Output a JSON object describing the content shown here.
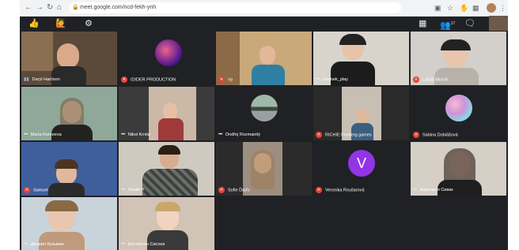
{
  "browser": {
    "url": "meet.google.com/ncd-fekh-ynh",
    "back_icon": "arrow-left",
    "forward_icon": "arrow-right",
    "reload_icon": "reload",
    "home_icon": "home"
  },
  "meet_toolbar": {
    "left_icons": [
      "thumbs-up-emoji",
      "person-raising-hand-emoji",
      "settings-gear"
    ],
    "right_icons": [
      "grid-layout",
      "people",
      "chat"
    ],
    "participant_count": "17"
  },
  "participants": [
    {
      "name": "Daryl Harrison",
      "status": "speaking"
    },
    {
      "name": "IDIDER PRODUCTION",
      "status": "muted"
    },
    {
      "name": "Vy",
      "status": "muted"
    },
    {
      "name": "Lisenek_play",
      "status": "more"
    },
    {
      "name": "Lukáš Muroň",
      "status": "muted"
    },
    {
      "name": "Maria Korneeva",
      "status": "more"
    },
    {
      "name": "Nikol Krnita",
      "status": "more"
    },
    {
      "name": "Ondřej Rozmanitý",
      "status": "more"
    },
    {
      "name": "RICHIE Freiberg games",
      "status": "muted"
    },
    {
      "name": "Sabina Dobiášová",
      "status": "muted"
    },
    {
      "name": "Samuel",
      "status": "muted"
    },
    {
      "name": "Shakh ff",
      "status": "more"
    },
    {
      "name": "Sofie Ďaďo",
      "status": "muted"
    },
    {
      "name": "Veronika Roušarová",
      "status": "muted"
    },
    {
      "name": "Анастасія Сивак",
      "status": "more"
    },
    {
      "name": "Даниил Кузьмин",
      "status": "more"
    },
    {
      "name": "Костянтин Сисоєв",
      "status": "more"
    }
  ],
  "veronika_initial": "V",
  "colors": {
    "meet_bg": "#202124",
    "mic_off_red": "#ea4335",
    "initial_circle": "#9334e6"
  }
}
